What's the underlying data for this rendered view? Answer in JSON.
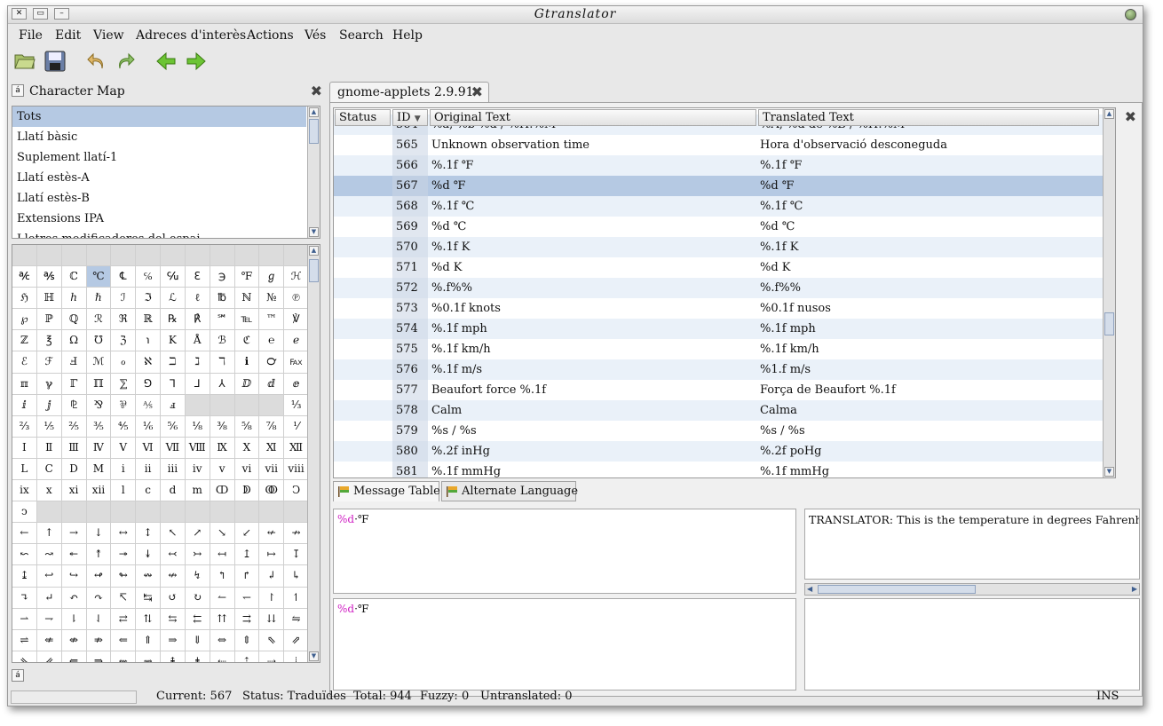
{
  "window": {
    "title": "Gtranslator"
  },
  "menu": [
    "File",
    "Edit",
    "View",
    "Adreces d'interès",
    "Actions",
    "Vés",
    "Search",
    "Help"
  ],
  "toolbar": {
    "icons": [
      "open-icon",
      "save-icon",
      "undo-icon",
      "redo-icon",
      "back-icon",
      "forward-icon"
    ]
  },
  "charmap": {
    "button_glyph": "á",
    "title": "Character Map",
    "scripts": [
      "Tots",
      "Llatí bàsic",
      "Suplement llatí-1",
      "Llatí estès-A",
      "Llatí estès-B",
      "Extensions IPA",
      "Lletres modificadores del espai"
    ],
    "selected_script": "Tots",
    "grid": [
      [
        "",
        "",
        "",
        "",
        "",
        "",
        "",
        "",
        "",
        "",
        "",
        ""
      ],
      [
        "℀",
        "℁",
        "ℂ",
        "℃",
        "℄",
        "℅",
        "℆",
        "ℇ",
        "℈",
        "℉",
        "ℊ",
        "ℋ"
      ],
      [
        "ℌ",
        "ℍ",
        "ℎ",
        "ℏ",
        "ℐ",
        "ℑ",
        "ℒ",
        "ℓ",
        "℔",
        "ℕ",
        "№",
        "℗"
      ],
      [
        "℘",
        "ℙ",
        "ℚ",
        "ℛ",
        "ℜ",
        "ℝ",
        "℞",
        "℟",
        "℠",
        "℡",
        "™",
        "℣"
      ],
      [
        "ℤ",
        "℥",
        "Ω",
        "℧",
        "ℨ",
        "℩",
        "K",
        "Å",
        "ℬ",
        "ℭ",
        "℮",
        "ℯ"
      ],
      [
        "ℰ",
        "ℱ",
        "Ⅎ",
        "ℳ",
        "ℴ",
        "ℵ",
        "ℶ",
        "ℷ",
        "ℸ",
        "ℹ",
        "℺",
        "℻"
      ],
      [
        "ℼ",
        "ℽ",
        "ℾ",
        "ℿ",
        "⅀",
        "⅁",
        "⅂",
        "⅃",
        "⅄",
        "ⅅ",
        "ⅆ",
        "ⅇ"
      ],
      [
        "ⅈ",
        "ⅉ",
        "⅊",
        "⅋",
        "⅌",
        "⅍",
        "ⅎ",
        "",
        "",
        "",
        "",
        "⅓"
      ],
      [
        "⅔",
        "⅕",
        "⅖",
        "⅗",
        "⅘",
        "⅙",
        "⅚",
        "⅛",
        "⅜",
        "⅝",
        "⅞",
        "⅟"
      ],
      [
        "Ⅰ",
        "Ⅱ",
        "Ⅲ",
        "Ⅳ",
        "Ⅴ",
        "Ⅵ",
        "Ⅶ",
        "Ⅷ",
        "Ⅸ",
        "Ⅹ",
        "Ⅺ",
        "Ⅻ"
      ],
      [
        "Ⅼ",
        "Ⅽ",
        "Ⅾ",
        "Ⅿ",
        "ⅰ",
        "ⅱ",
        "ⅲ",
        "ⅳ",
        "ⅴ",
        "ⅵ",
        "ⅶ",
        "ⅷ"
      ],
      [
        "ⅸ",
        "ⅹ",
        "ⅺ",
        "ⅻ",
        "ⅼ",
        "ⅽ",
        "ⅾ",
        "ⅿ",
        "ↀ",
        "ↁ",
        "ↂ",
        "Ↄ"
      ],
      [
        "ↄ",
        "",
        "",
        "",
        "",
        "",
        "",
        "",
        "",
        "",
        "",
        ""
      ],
      [
        "←",
        "↑",
        "→",
        "↓",
        "↔",
        "↕",
        "↖",
        "↗",
        "↘",
        "↙",
        "↚",
        "↛"
      ],
      [
        "↜",
        "↝",
        "↞",
        "↟",
        "↠",
        "↡",
        "↢",
        "↣",
        "↤",
        "↥",
        "↦",
        "↧"
      ],
      [
        "↨",
        "↩",
        "↪",
        "↫",
        "↬",
        "↭",
        "↮",
        "↯",
        "↰",
        "↱",
        "↲",
        "↳"
      ],
      [
        "↴",
        "↵",
        "↶",
        "↷",
        "↸",
        "↹",
        "↺",
        "↻",
        "↼",
        "↽",
        "↾",
        "↿"
      ],
      [
        "⇀",
        "⇁",
        "⇂",
        "⇃",
        "⇄",
        "⇅",
        "⇆",
        "⇇",
        "⇈",
        "⇉",
        "⇊",
        "⇋"
      ],
      [
        "⇌",
        "⇍",
        "⇎",
        "⇏",
        "⇐",
        "⇑",
        "⇒",
        "⇓",
        "⇔",
        "⇕",
        "⇖",
        "⇗"
      ],
      [
        "⇘",
        "⇙",
        "⇚",
        "⇛",
        "⇜",
        "⇝",
        "⇞",
        "⇟",
        "⇠",
        "⇡",
        "⇢",
        "⇣"
      ]
    ],
    "selected_char": "℃"
  },
  "file_tab": {
    "label": "gnome-applets 2.9.91"
  },
  "table": {
    "columns": [
      "Status",
      "ID",
      "Original Text",
      "Translated Text"
    ],
    "rows": [
      {
        "id": "564",
        "original": "%a, %b %d / %H:%M",
        "translated": "%A, %d de %B / %H:%M"
      },
      {
        "id": "565",
        "original": "Unknown observation time",
        "translated": "Hora d'observació desconeguda"
      },
      {
        "id": "566",
        "original": "%.1f ℉",
        "translated": "%.1f ℉"
      },
      {
        "id": "567",
        "original": "%d ℉",
        "translated": "%d ℉"
      },
      {
        "id": "568",
        "original": "%.1f ℃",
        "translated": "%.1f ℃"
      },
      {
        "id": "569",
        "original": "%d ℃",
        "translated": "%d ℃"
      },
      {
        "id": "570",
        "original": "%.1f K",
        "translated": "%.1f K"
      },
      {
        "id": "571",
        "original": "%d K",
        "translated": "%d K"
      },
      {
        "id": "572",
        "original": "%.f%%",
        "translated": "%.f%%"
      },
      {
        "id": "573",
        "original": "%0.1f knots",
        "translated": "%0.1f nusos"
      },
      {
        "id": "574",
        "original": "%.1f mph",
        "translated": "%.1f mph"
      },
      {
        "id": "575",
        "original": "%.1f km/h",
        "translated": "%.1f km/h"
      },
      {
        "id": "576",
        "original": "%.1f m/s",
        "translated": "%1.f m/s"
      },
      {
        "id": "577",
        "original": "Beaufort force %.1f",
        "translated": "Força de Beaufort %.1f"
      },
      {
        "id": "578",
        "original": "Calm",
        "translated": "Calma"
      },
      {
        "id": "579",
        "original": "%s / %s",
        "translated": "%s / %s"
      },
      {
        "id": "580",
        "original": "%.2f inHg",
        "translated": "%.2f poHg"
      },
      {
        "id": "581",
        "original": "%.1f mmHg",
        "translated": "%.1f mmHg"
      }
    ],
    "selected_id": "567"
  },
  "bottom_tabs": [
    "Message Table",
    "Alternate Language"
  ],
  "editor": {
    "original_fmt": "%d",
    "original_rest": "·℉",
    "translation_fmt": "%d",
    "translation_rest": "·℉",
    "comment": "TRANSLATOR: This is the temperature in degrees Fahrenheit"
  },
  "status": {
    "current": "Current: 567",
    "state": "Status: Traduïdes",
    "total": "Total: 944",
    "fuzzy": "Fuzzy: 0",
    "untranslated": "Untranslated: 0",
    "mode": "INS"
  }
}
